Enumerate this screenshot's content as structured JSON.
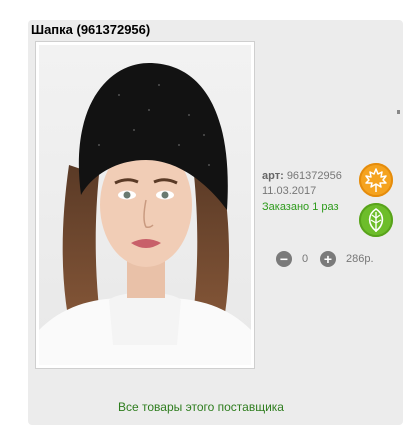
{
  "product": {
    "title": "Шапка (961372956)",
    "article_label": "арт:",
    "article_number": "961372956",
    "date": "11.03.2017",
    "ordered_text": "Заказано 1 раз",
    "quantity": "0",
    "price": "286р."
  },
  "icons": {
    "image": "product-photo-woman-black-beanie",
    "badge_orange": "maple-leaf-icon",
    "badge_green": "leaf-icon",
    "decrement": "minus-circle-icon",
    "increment": "plus-circle-icon"
  },
  "colors": {
    "card_bg": "#ececec",
    "link_green": "#2e7d1e",
    "ordered_green": "#2e9b1c",
    "badge_orange": "#f5a31f",
    "badge_green": "#6dbd2a",
    "button_gray": "#7a7a7a"
  },
  "footer": {
    "supplier_link": "Все товары этого поставщика"
  }
}
